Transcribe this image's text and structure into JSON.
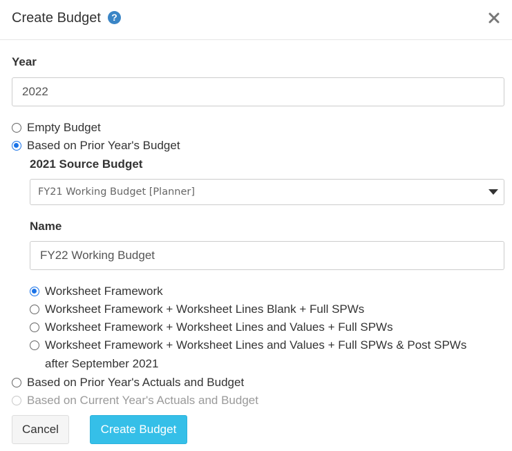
{
  "dialog": {
    "title": "Create Budget",
    "help_icon": "?",
    "close_icon": "close-icon"
  },
  "year": {
    "label": "Year",
    "value": "2022"
  },
  "budget_options": [
    {
      "label": "Empty Budget",
      "selected": false,
      "disabled": false
    },
    {
      "label": "Based on Prior Year's Budget",
      "selected": true,
      "disabled": false
    },
    {
      "label": "Based on Prior Year's Actuals and Budget",
      "selected": false,
      "disabled": false
    },
    {
      "label": "Based on Current Year's Actuals and Budget",
      "selected": false,
      "disabled": true
    }
  ],
  "source_budget": {
    "label": "2021 Source Budget",
    "selected": "FY21 Working Budget [Planner]"
  },
  "name": {
    "label": "Name",
    "value": "FY22 Working Budget"
  },
  "framework_options": [
    {
      "label": "Worksheet Framework",
      "selected": true
    },
    {
      "label": "Worksheet Framework + Worksheet Lines Blank + Full SPWs",
      "selected": false
    },
    {
      "label": "Worksheet Framework + Worksheet Lines and Values + Full SPWs",
      "selected": false
    },
    {
      "label": "Worksheet Framework + Worksheet Lines and Values + Full SPWs & Post SPWs",
      "selected": false,
      "continuation": "after September 2021"
    }
  ],
  "buttons": {
    "cancel": "Cancel",
    "create": "Create Budget"
  },
  "colors": {
    "accent": "#1a73e8",
    "primary_button": "#35bfe8",
    "help_icon": "#3a85c6"
  }
}
